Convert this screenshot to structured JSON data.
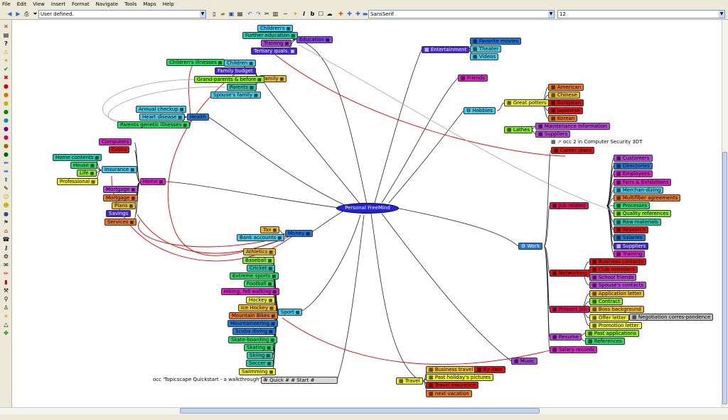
{
  "menu": [
    "File",
    "Edit",
    "View",
    "Insert",
    "Format",
    "Navigate",
    "Tools",
    "Maps",
    "Help"
  ],
  "toolbar": {
    "style_select": "User defined.",
    "font_select": "SansSerif",
    "size_select": "12"
  },
  "root": "Personal FreeMind",
  "nodes": {
    "education": "Education",
    "childrens": "Children's",
    "further_education": "Further education",
    "training": "Training",
    "tertiary": "Tertiary quals.",
    "family": "Family",
    "children": "Children",
    "children_illnesses": "Children's illnesses",
    "family_budget": "Family budget",
    "grandparents": "Grand-parents & before",
    "parents": "Parents",
    "spouses_family": "Spouse's family",
    "health": "Health",
    "annual_checkup": "Annual checkup",
    "heart_disease": "Heart disease",
    "parents_genetic": "Parents genetic illnesses",
    "home": "Home",
    "computers": "Computers",
    "cooks": "Cooks",
    "insurance": "Insurance",
    "home_contents": "Home contents",
    "house": "House",
    "life": "Life",
    "professional": "Professional",
    "mortgage1": "Mortgage",
    "mortgage2": "Mortgage",
    "plans": "Plans",
    "savings": "Savings",
    "services": "Services",
    "money": "Money",
    "tax": "Tax",
    "bank_accounts": "Bank accounts",
    "sport": "Sport",
    "athletics": "Athletics",
    "baseball": "Baseball",
    "cricket": "Cricket",
    "extreme_sports": "Extreme sports",
    "football": "Football",
    "hiking": "Hiking, fell walking",
    "hockey": "Hockey",
    "ice_hockey": "Ice Hockey",
    "mountain_bikes": "Mountain Bikes",
    "mountaineering": "Mountaineering",
    "scuba": "Scuba diving",
    "skateboarding": "Skate-boarding",
    "skating": "Skating",
    "skiing": "Skiing",
    "soccer": "Soccer",
    "swimming": "Swimming",
    "quick_start": "# Quick #  # Start #",
    "topicscape_link": "occ 'Topicscape Quickstart - a walkthrough'",
    "entertainment": "Entertainment",
    "favorite_movies": "Favorite movies",
    "theater": "Theater",
    "videos": "Videos",
    "friends": "Friends",
    "hobbies": "Hobbies",
    "great_potters": "Great potters",
    "american": "American",
    "chinese": "Chinese",
    "european": "European",
    "japanese": "Japanese",
    "korean": "Korean",
    "lathes": "Lathes",
    "maintenance": "Maintenance information",
    "suppliers_h": "Suppliers",
    "work": "Work",
    "occ_security": "occ 2 in Computer Security 3DT",
    "career_plans": "Career plans",
    "job_related": "Job related",
    "customers": "Customers",
    "directories": "Directories",
    "employees": "Employees",
    "fairs": "Fairs & Exhibitions",
    "merchandising": "Merchan-dizing",
    "multifiber": "Multifiber agreements",
    "processes": "Processes",
    "quality": "Quality references",
    "raw_materials": "Raw materials",
    "research": "Research",
    "salaries": "Salaries",
    "suppliers_w": "Suppliers",
    "training_w": "Training",
    "networking": "Networking",
    "business_contacts": "Business contacts",
    "club_members": "Club members",
    "school_friends": "School friends",
    "spouses_contacts": "Spouse's contacts",
    "present_job": "Present job",
    "application_letter": "Application letter",
    "contract": "Contract",
    "boss_background": "Boss background",
    "offer_letter": "Offer letter",
    "negotiation": "Negotiation corres-pondence",
    "promotion_letter": "Promotion letter",
    "resume": "Resume",
    "past_applications": "Past applications",
    "references": "References",
    "salary_records": "Salary records",
    "music": "Music",
    "travel": "Travel",
    "business_travel": "Business travel",
    "by_date": "By date",
    "past_holidays": "Past holiday's pictures",
    "travel_insurance": "Travel insurance",
    "next_vacation": "next vacation"
  },
  "colors": {
    "root": "#2222dd",
    "canvas": "#ffffff",
    "link_red": "#dd0000",
    "link_gray": "#aaaaaa"
  }
}
